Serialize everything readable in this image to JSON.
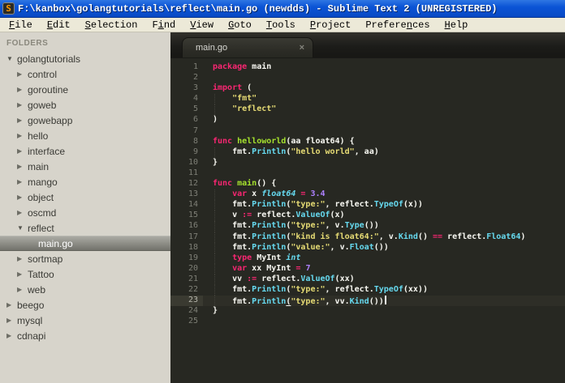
{
  "theme": {
    "bg": "#272822",
    "txt": "#f8f8f2",
    "kw": "#f92672",
    "fn": "#a6e22e",
    "str": "#e6db74",
    "typ": "#66d9ef",
    "cal": "#66d9ef",
    "num": "#ae81ff",
    "titlebar": "#0b54d6",
    "menubar": "#ece9d8",
    "sidebar": "#d7d4cb"
  },
  "window": {
    "title": "F:\\kanbox\\golangtutorials\\reflect\\main.go (newdds) - Sublime Text 2 (UNREGISTERED)",
    "icon_letter": "S"
  },
  "menu": {
    "items": [
      {
        "label": "File",
        "mnemonic_index": 0
      },
      {
        "label": "Edit",
        "mnemonic_index": 0
      },
      {
        "label": "Selection",
        "mnemonic_index": 0
      },
      {
        "label": "Find",
        "mnemonic_index": 1
      },
      {
        "label": "View",
        "mnemonic_index": 0
      },
      {
        "label": "Goto",
        "mnemonic_index": 0
      },
      {
        "label": "Tools",
        "mnemonic_index": 0
      },
      {
        "label": "Project",
        "mnemonic_index": 0
      },
      {
        "label": "Preferences",
        "mnemonic_index": 7
      },
      {
        "label": "Help",
        "mnemonic_index": 0
      }
    ]
  },
  "sidebar": {
    "header": "FOLDERS",
    "items": [
      {
        "label": "golangtutorials",
        "depth": 0,
        "state": "expanded"
      },
      {
        "label": "control",
        "depth": 1,
        "state": "collapsed"
      },
      {
        "label": "goroutine",
        "depth": 1,
        "state": "collapsed"
      },
      {
        "label": "goweb",
        "depth": 1,
        "state": "collapsed"
      },
      {
        "label": "gowebapp",
        "depth": 1,
        "state": "collapsed"
      },
      {
        "label": "hello",
        "depth": 1,
        "state": "collapsed"
      },
      {
        "label": "interface",
        "depth": 1,
        "state": "collapsed"
      },
      {
        "label": "main",
        "depth": 1,
        "state": "collapsed"
      },
      {
        "label": "mango",
        "depth": 1,
        "state": "collapsed"
      },
      {
        "label": "object",
        "depth": 1,
        "state": "collapsed"
      },
      {
        "label": "oscmd",
        "depth": 1,
        "state": "collapsed"
      },
      {
        "label": "reflect",
        "depth": 1,
        "state": "expanded"
      },
      {
        "label": "main.go",
        "depth": 2,
        "state": "file",
        "selected": true
      },
      {
        "label": "sortmap",
        "depth": 1,
        "state": "collapsed"
      },
      {
        "label": "Tattoo",
        "depth": 1,
        "state": "collapsed"
      },
      {
        "label": "web",
        "depth": 1,
        "state": "collapsed"
      },
      {
        "label": "beego",
        "depth": 0,
        "state": "collapsed"
      },
      {
        "label": "mysql",
        "depth": 0,
        "state": "collapsed"
      },
      {
        "label": "cdnapi",
        "depth": 0,
        "state": "collapsed"
      }
    ]
  },
  "tabs": [
    {
      "label": "main.go",
      "close": "×",
      "active": true
    }
  ],
  "editor": {
    "active_line": 23,
    "lines": [
      {
        "num": 1,
        "tokens": [
          [
            "k",
            "package"
          ],
          [
            "p",
            " main"
          ]
        ]
      },
      {
        "num": 2,
        "tokens": []
      },
      {
        "num": 3,
        "tokens": [
          [
            "k",
            "import"
          ],
          [
            "p",
            " ("
          ]
        ]
      },
      {
        "num": 4,
        "tokens": [
          [
            "p",
            "    "
          ],
          [
            "s",
            "\"fmt\""
          ]
        ]
      },
      {
        "num": 5,
        "tokens": [
          [
            "p",
            "    "
          ],
          [
            "s",
            "\"reflect\""
          ]
        ]
      },
      {
        "num": 6,
        "tokens": [
          [
            "p",
            ")"
          ]
        ]
      },
      {
        "num": 7,
        "tokens": []
      },
      {
        "num": 8,
        "tokens": [
          [
            "k",
            "func"
          ],
          [
            "f",
            " helloworld"
          ],
          [
            "p",
            "(aa float64) {"
          ]
        ]
      },
      {
        "num": 9,
        "tokens": [
          [
            "p",
            "    fmt."
          ],
          [
            "c",
            "Println"
          ],
          [
            "p",
            "("
          ],
          [
            "s",
            "\"hello world\""
          ],
          [
            "p",
            ", aa)"
          ]
        ]
      },
      {
        "num": 10,
        "tokens": [
          [
            "p",
            "}"
          ]
        ]
      },
      {
        "num": 11,
        "tokens": []
      },
      {
        "num": 12,
        "tokens": [
          [
            "k",
            "func"
          ],
          [
            "f",
            " main"
          ],
          [
            "p",
            "() {"
          ]
        ]
      },
      {
        "num": 13,
        "tokens": [
          [
            "p",
            "    "
          ],
          [
            "k",
            "var"
          ],
          [
            "p",
            " x "
          ],
          [
            "t",
            "float64"
          ],
          [
            "p",
            " "
          ],
          [
            "k",
            "="
          ],
          [
            "p",
            " "
          ],
          [
            "n",
            "3.4"
          ]
        ]
      },
      {
        "num": 14,
        "tokens": [
          [
            "p",
            "    fmt."
          ],
          [
            "c",
            "Println"
          ],
          [
            "p",
            "("
          ],
          [
            "s",
            "\"type:\""
          ],
          [
            "p",
            ", reflect."
          ],
          [
            "c",
            "TypeOf"
          ],
          [
            "p",
            "(x))"
          ]
        ]
      },
      {
        "num": 15,
        "tokens": [
          [
            "p",
            "    v "
          ],
          [
            "k",
            ":="
          ],
          [
            "p",
            " reflect."
          ],
          [
            "c",
            "ValueOf"
          ],
          [
            "p",
            "(x)"
          ]
        ]
      },
      {
        "num": 16,
        "tokens": [
          [
            "p",
            "    fmt."
          ],
          [
            "c",
            "Println"
          ],
          [
            "p",
            "("
          ],
          [
            "s",
            "\"type:\""
          ],
          [
            "p",
            ", v."
          ],
          [
            "c",
            "Type"
          ],
          [
            "p",
            "())"
          ]
        ]
      },
      {
        "num": 17,
        "tokens": [
          [
            "p",
            "    fmt."
          ],
          [
            "c",
            "Println"
          ],
          [
            "p",
            "("
          ],
          [
            "s",
            "\"kind is float64:\""
          ],
          [
            "p",
            ", v."
          ],
          [
            "c",
            "Kind"
          ],
          [
            "p",
            "() "
          ],
          [
            "k",
            "=="
          ],
          [
            "p",
            " reflect."
          ],
          [
            "c",
            "Float64"
          ],
          [
            "p",
            ")"
          ]
        ]
      },
      {
        "num": 18,
        "tokens": [
          [
            "p",
            "    fmt."
          ],
          [
            "c",
            "Println"
          ],
          [
            "p",
            "("
          ],
          [
            "s",
            "\"value:\""
          ],
          [
            "p",
            ", v."
          ],
          [
            "c",
            "Float"
          ],
          [
            "p",
            "())"
          ]
        ]
      },
      {
        "num": 19,
        "tokens": [
          [
            "p",
            "    "
          ],
          [
            "k",
            "type"
          ],
          [
            "p",
            " MyInt "
          ],
          [
            "t",
            "int"
          ]
        ]
      },
      {
        "num": 20,
        "tokens": [
          [
            "p",
            "    "
          ],
          [
            "k",
            "var"
          ],
          [
            "p",
            " xx MyInt "
          ],
          [
            "k",
            "="
          ],
          [
            "p",
            " "
          ],
          [
            "n",
            "7"
          ]
        ]
      },
      {
        "num": 21,
        "tokens": [
          [
            "p",
            "    vv "
          ],
          [
            "k",
            ":="
          ],
          [
            "p",
            " reflect."
          ],
          [
            "c",
            "ValueOf"
          ],
          [
            "p",
            "(xx)"
          ]
        ]
      },
      {
        "num": 22,
        "tokens": [
          [
            "p",
            "    fmt."
          ],
          [
            "c",
            "Println"
          ],
          [
            "p",
            "("
          ],
          [
            "s",
            "\"type:\""
          ],
          [
            "p",
            ", reflect."
          ],
          [
            "c",
            "TypeOf"
          ],
          [
            "p",
            "(xx))"
          ]
        ]
      },
      {
        "num": 23,
        "tokens": [
          [
            "p",
            "    fmt."
          ],
          [
            "c",
            "Println"
          ],
          [
            "b",
            "("
          ],
          [
            "s",
            "\"type:\""
          ],
          [
            "p",
            ", vv."
          ],
          [
            "c",
            "Kind"
          ],
          [
            "p",
            "())"
          ]
        ]
      },
      {
        "num": 24,
        "tokens": [
          [
            "p",
            "}"
          ]
        ]
      },
      {
        "num": 25,
        "tokens": []
      }
    ]
  }
}
